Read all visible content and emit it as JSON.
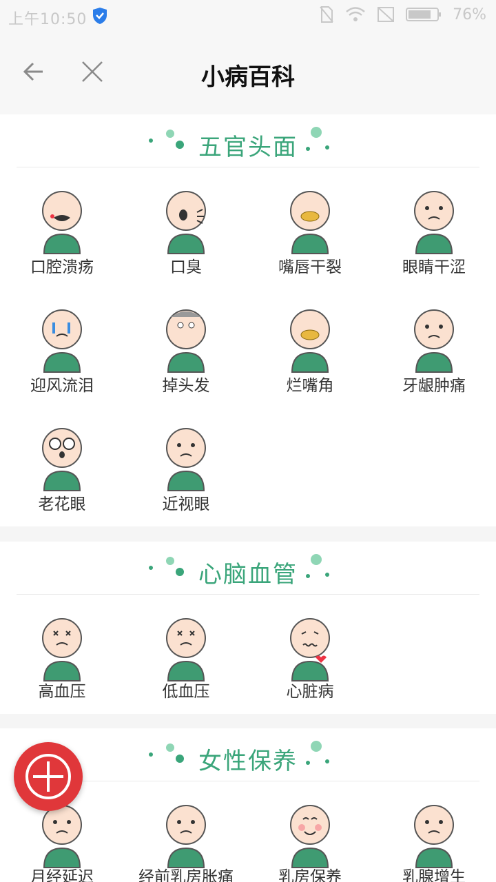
{
  "status_bar": {
    "time": "上午10:50",
    "battery_percent": "76%"
  },
  "title_bar": {
    "title": "小病百科",
    "back_icon": "back-arrow-icon",
    "close_icon": "close-icon"
  },
  "colors": {
    "accent_green": "#3aa57a",
    "fab_red": "#e0373a",
    "skin": "#fbe1d0",
    "shirt": "#3f9b72"
  },
  "sections": [
    {
      "title": "五官头面",
      "items": [
        {
          "label": "口腔溃疡",
          "icon": "mouth-ulcer-icon"
        },
        {
          "label": "口臭",
          "icon": "bad-breath-icon"
        },
        {
          "label": "嘴唇干裂",
          "icon": "chapped-lips-icon"
        },
        {
          "label": "眼睛干涩",
          "icon": "dry-eyes-icon"
        },
        {
          "label": "迎风流泪",
          "icon": "tearing-in-wind-icon"
        },
        {
          "label": "掉头发",
          "icon": "hair-loss-icon"
        },
        {
          "label": "烂嘴角",
          "icon": "angular-cheilitis-icon"
        },
        {
          "label": "牙龈肿痛",
          "icon": "gum-pain-icon"
        },
        {
          "label": "老花眼",
          "icon": "presbyopia-icon"
        },
        {
          "label": "近视眼",
          "icon": "myopia-icon"
        }
      ]
    },
    {
      "title": "心脑血管",
      "items": [
        {
          "label": "高血压",
          "icon": "high-blood-pressure-icon"
        },
        {
          "label": "低血压",
          "icon": "low-blood-pressure-icon"
        },
        {
          "label": "心脏病",
          "icon": "heart-disease-icon"
        }
      ]
    },
    {
      "title": "女性保养",
      "items": [
        {
          "label": "月经延迟",
          "icon": "delayed-period-icon"
        },
        {
          "label": "经前乳房胀痛",
          "icon": "premenstrual-breast-pain-icon"
        },
        {
          "label": "乳房保养",
          "icon": "breast-care-icon"
        },
        {
          "label": "乳腺增生",
          "icon": "breast-hyperplasia-icon"
        }
      ]
    }
  ],
  "fab": {
    "icon": "plus-circle-icon"
  }
}
